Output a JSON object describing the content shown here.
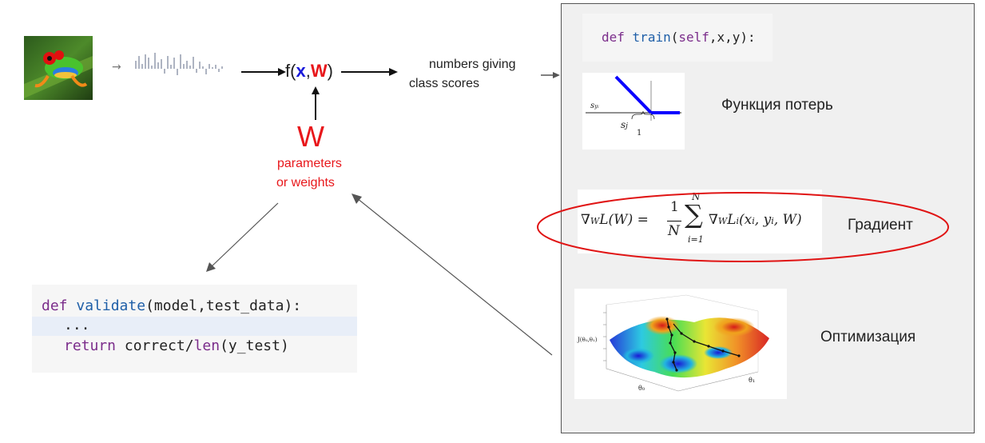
{
  "pipeline": {
    "function_parts": {
      "prefix": "f(",
      "x": "x",
      "comma": ",",
      "w": "W",
      "suffix": ")"
    },
    "w_label": "W",
    "param_line1": "parameters",
    "param_line2": "or weights",
    "scores_line1": "numbers giving",
    "scores_line2": "class scores"
  },
  "validate_code": {
    "kw_def": "def",
    "fn_name": "validate",
    "args": "(model,test_data):",
    "dots": "...",
    "kw_return": "return",
    "ret_mid": "correct/",
    "fn_len": "len",
    "ret_end": "(y_test)"
  },
  "train_code": {
    "kw_def": "def",
    "fn_name": "train",
    "open": "(",
    "self_kw": "self",
    "args": ",x,y):"
  },
  "loss_plot": {
    "ylabel_main": "s",
    "ylabel_sub": "y",
    "ylabel_subsub": "i",
    "xlabel_main": "s",
    "xlabel_sub": "j",
    "tick": "1"
  },
  "gradient_formula": {
    "nabla": "∇",
    "sub_w": "W",
    "lhs": "L(W) =",
    "frac_num": "1",
    "frac_den": "N",
    "sum_top": "N",
    "sigma": "∑",
    "sum_bottom": "i=1",
    "rhs": "L",
    "rhs_sub": "i",
    "rhs_args": "(x",
    "x_sub": "i",
    "mid": ", y",
    "y_sub": "i",
    "end": ", W)"
  },
  "surface_plot": {
    "zlabel": "J(θ₀,θ₁)",
    "x_axis": "θ₀",
    "y_axis": "θ₁"
  },
  "captions": {
    "loss": "Функция потерь",
    "gradient": "Градиент",
    "optimization": "Оптимизация"
  },
  "colors": {
    "blue_x": "#1a1adb",
    "red_w": "#e8171b",
    "ellipse": "#e01414",
    "loss_line": "#0a00ff",
    "panel_bg": "#f0f0f0"
  }
}
